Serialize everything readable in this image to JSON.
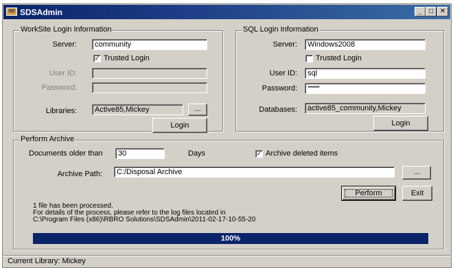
{
  "window": {
    "title": "SDSAdmin",
    "app_icon": "SD",
    "minimize": "_",
    "maximize": "□",
    "close": "✕"
  },
  "worksite": {
    "legend": "WorkSite Login Information",
    "server_label": "Server:",
    "server_value": "community",
    "trusted_label": "Trusted Login",
    "trusted_checked": "✓",
    "userid_label": "User ID:",
    "userid_value": "",
    "password_label": "Password:",
    "password_value": "",
    "libraries_label": "Libraries:",
    "libraries_value": "Active85,Mickey",
    "browse_label": "...",
    "login_label": "Login"
  },
  "sql": {
    "legend": "SQL Login Information",
    "server_label": "Server:",
    "server_value": "Windows2008",
    "trusted_label": "Trusted Login",
    "trusted_checked": "",
    "userid_label": "User ID:",
    "userid_value": "sql",
    "password_label": "Password:",
    "password_value": "********",
    "databases_label": "Databases:",
    "databases_value": "active85_community,Mickey",
    "login_label": "Login"
  },
  "archive": {
    "legend": "Perform Archive",
    "older_label": "Documents older than",
    "older_value": "30",
    "days_label": "Days",
    "deleted_label": "Archive deleted items",
    "deleted_checked": "✓",
    "path_label": "Archive Path:",
    "path_value": "C:/Disposal Archive",
    "browse_label": "...",
    "perform_label": "Perform",
    "exit_label": "Exit"
  },
  "messages": [
    "1 file has been processed.",
    "For details of the process, please refer to the log files located in",
    "C:\\Program Files (x86)\\RBRO Solutions\\SDSAdmin\\2011-02-17-10-55-20"
  ],
  "progress": {
    "value": 100,
    "label": "100%"
  },
  "status": {
    "text": "Current Library: Mickey"
  },
  "colors": {
    "titlebar": "#0a246a",
    "face": "#d4d0c8",
    "progress": "#0a246a"
  }
}
